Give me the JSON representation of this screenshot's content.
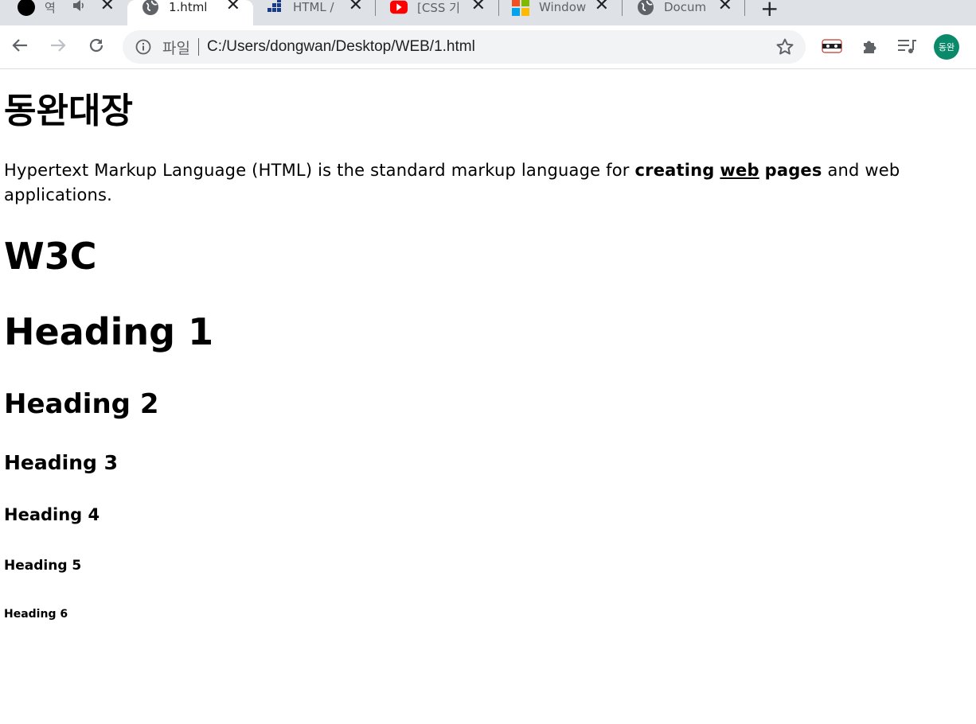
{
  "tabs": [
    {
      "title": "역",
      "favicon": "black-circle-icon",
      "audio": true
    },
    {
      "title": "1.html",
      "favicon": "globe-icon",
      "active": true
    },
    {
      "title": "HTML /",
      "favicon": "bars-logo-icon"
    },
    {
      "title": "[CSS 기",
      "favicon": "youtube-icon"
    },
    {
      "title": "Window",
      "favicon": "windows-logo-icon"
    },
    {
      "title": "Docum",
      "favicon": "globe-icon"
    }
  ],
  "toolbar": {
    "omnibox_chip": "파일",
    "url": "C:/Users/dongwan/Desktop/WEB/1.html",
    "avatar_label": "동완"
  },
  "page": {
    "title": "동완대장",
    "intro": {
      "before": "Hypertext Markup Language (HTML) is the standard markup language for ",
      "bold1": "creating",
      "underlined": "web",
      "bold2": "pages",
      "after": " and web applications."
    },
    "w3c": "W3C",
    "h1": "Heading 1",
    "h2": "Heading 2",
    "h3": "Heading 3",
    "h4": "Heading 4",
    "h5": "Heading 5",
    "h6": "Heading 6"
  },
  "colors": {
    "tabstrip_bg": "#dee1e6",
    "omnibox_bg": "#f1f3f4",
    "avatar_bg": "#0b8a6b"
  }
}
